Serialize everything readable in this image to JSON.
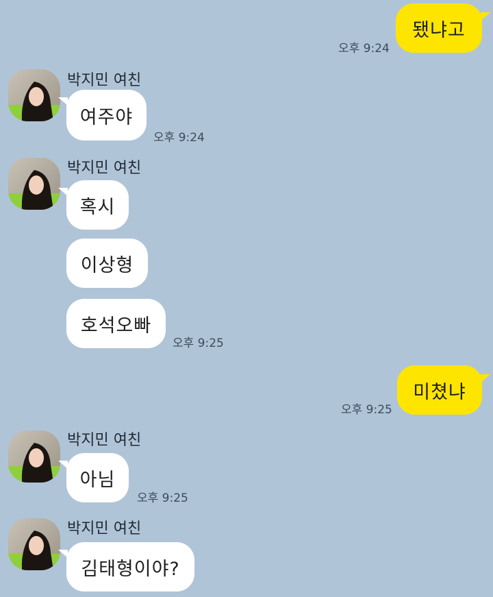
{
  "chat": {
    "colors": {
      "background": "#b0c4d8",
      "my_bubble": "#fee500",
      "their_bubble": "#ffffff"
    },
    "sender_name": "박지민 여친",
    "avatar_icon": "profile-photo-avatar",
    "messages": {
      "m1": {
        "text": "됐냐고",
        "time": "오후 9:24"
      },
      "m2": {
        "text": "여주야",
        "time": "오후 9:24"
      },
      "m3": {
        "text": "혹시"
      },
      "m4": {
        "text": "이상형"
      },
      "m5": {
        "text": "호석오빠",
        "time": "오후 9:25"
      },
      "m6": {
        "text": "미쳤냐",
        "time": "오후 9:25"
      },
      "m7": {
        "text": "아님",
        "time": "오후 9:25"
      },
      "m8": {
        "text": "김태형이야?"
      }
    }
  }
}
